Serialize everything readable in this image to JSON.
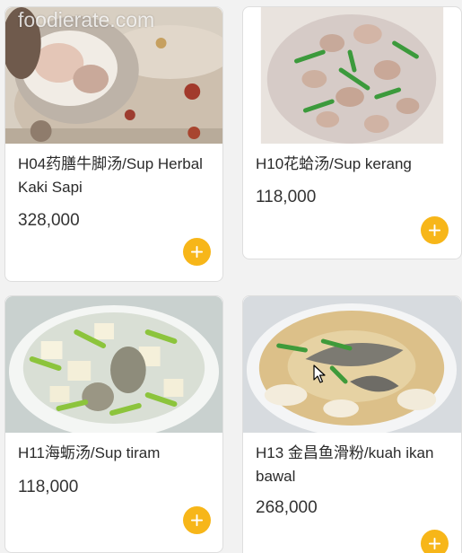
{
  "watermark": "foodierate.com",
  "colors": {
    "accent": "#f7b619",
    "card": "#ffffff",
    "background": "#f2f2f2"
  },
  "menu_items": [
    {
      "name": "H04药膳牛脚汤/Sup Herbal Kaki Sapi",
      "price": "328,000",
      "image": "herbal-beef-trotter-soup-photo",
      "add_icon": "plus-icon"
    },
    {
      "name": "H10花蛤汤/Sup kerang",
      "price": "118,000",
      "image": "clam-soup-photo",
      "add_icon": "plus-icon"
    },
    {
      "name": "H11海蛎汤/Sup tiram",
      "price": "118,000",
      "image": "oyster-tofu-soup-photo",
      "add_icon": "plus-icon"
    },
    {
      "name": "H13 金昌鱼滑粉/kuah ikan bawal",
      "price": "268,000",
      "image": "pomfret-fish-soup-photo",
      "add_icon": "plus-icon"
    }
  ]
}
